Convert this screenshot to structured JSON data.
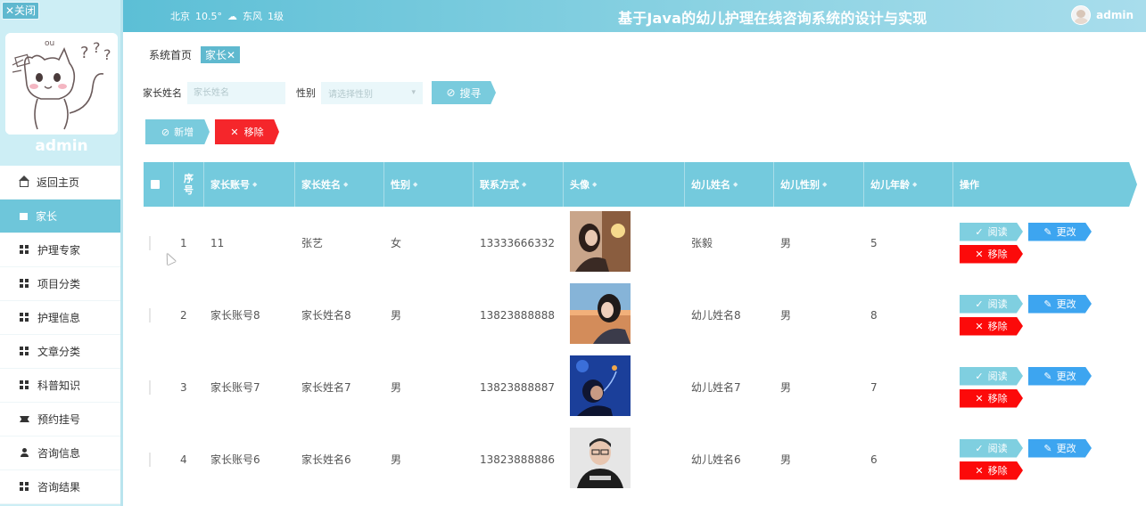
{
  "header": {
    "close_label": "✕关闭",
    "weather": {
      "city": "北京",
      "temp": "10.5°",
      "wind": "东风",
      "level": "1级"
    },
    "system_title": "基于Java的幼儿护理在线咨询系统的设计与实现",
    "username": "admin"
  },
  "sidebar": {
    "profile_name": "admin",
    "items": [
      {
        "label": "返回主页",
        "icon": "home-icon"
      },
      {
        "label": "家长",
        "icon": "book-icon",
        "active": true
      },
      {
        "label": "护理专家",
        "icon": "grid-icon"
      },
      {
        "label": "项目分类",
        "icon": "grid-icon"
      },
      {
        "label": "护理信息",
        "icon": "grid-icon"
      },
      {
        "label": "文章分类",
        "icon": "grid-icon"
      },
      {
        "label": "科普知识",
        "icon": "grid-icon"
      },
      {
        "label": "预约挂号",
        "icon": "ticket-icon"
      },
      {
        "label": "咨询信息",
        "icon": "user-icon"
      },
      {
        "label": "咨询结果",
        "icon": "grid-icon"
      }
    ]
  },
  "breadcrumb": {
    "home": "系统首页",
    "current": "家长✕"
  },
  "search": {
    "name_label": "家长姓名",
    "name_placeholder": "家长姓名",
    "gender_label": "性别",
    "gender_placeholder": "请选择性别",
    "button": "搜寻"
  },
  "actions": {
    "add": "新增",
    "remove": "移除"
  },
  "table": {
    "columns": {
      "seq": "序号",
      "account": "家长账号",
      "name": "家长姓名",
      "gender": "性别",
      "phone": "联系方式",
      "avatar": "头像",
      "child_name": "幼儿姓名",
      "child_gender": "幼儿性别",
      "child_age": "幼儿年龄",
      "ops": "操作"
    },
    "op_labels": {
      "read": "阅读",
      "edit": "更改",
      "delete": "移除"
    },
    "rows": [
      {
        "seq": "1",
        "account": "11",
        "name": "张艺",
        "gender": "女",
        "phone": "13333666332",
        "child_name": "张毅",
        "child_gender": "男",
        "child_age": "5"
      },
      {
        "seq": "2",
        "account": "家长账号8",
        "name": "家长姓名8",
        "gender": "男",
        "phone": "13823888888",
        "child_name": "幼儿姓名8",
        "child_gender": "男",
        "child_age": "8"
      },
      {
        "seq": "3",
        "account": "家长账号7",
        "name": "家长姓名7",
        "gender": "男",
        "phone": "13823888887",
        "child_name": "幼儿姓名7",
        "child_gender": "男",
        "child_age": "7"
      },
      {
        "seq": "4",
        "account": "家长账号6",
        "name": "家长姓名6",
        "gender": "男",
        "phone": "13823888886",
        "child_name": "幼儿姓名6",
        "child_gender": "男",
        "child_age": "6"
      }
    ]
  },
  "colors": {
    "accent": "#74cadd",
    "danger": "#f5262b",
    "edit": "#3da5f0",
    "sidebar_bg": "#cdeef5"
  }
}
